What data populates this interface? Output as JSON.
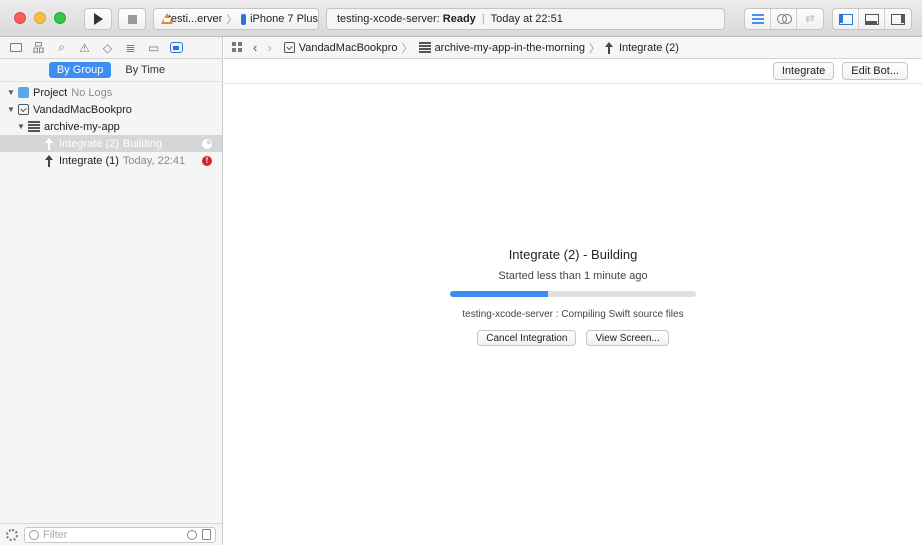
{
  "toolbar": {
    "scheme_name": "testi...erver",
    "device_name": "iPhone 7 Plus",
    "activity_server": "testing-xcode-server:",
    "activity_state": "Ready",
    "activity_time": "Today at 22:51"
  },
  "navigator": {
    "by_group_label": "By Group",
    "by_time_label": "By Time",
    "filter_placeholder": "Filter",
    "tree": {
      "project": {
        "label": "Project",
        "note": "No Logs"
      },
      "bot": {
        "label": "VandadMacBookpro"
      },
      "scheme": {
        "label": "archive-my-app"
      },
      "integration_2": {
        "label": "Integrate (2)",
        "note": "Building"
      },
      "integration_1": {
        "label": "Integrate (1)",
        "note": "Today, 22:41",
        "status_glyph": "!"
      }
    }
  },
  "jumpbar": {
    "crumbs": [
      "VandadMacBookpro",
      "archive-my-app-in-the-morning",
      "Integrate (2)"
    ]
  },
  "editor": {
    "integrate_button": "Integrate",
    "edit_bot_button": "Edit Bot...",
    "title": "Integrate (2) - Building",
    "subtitle": "Started less than 1 minute ago",
    "progress": 0.4,
    "status": "testing-xcode-server : Compiling Swift source files",
    "cancel_button": "Cancel Integration",
    "view_screen_button": "View Screen..."
  },
  "colors": {
    "accent": "#3c8ef2",
    "error": "#d8232a"
  }
}
